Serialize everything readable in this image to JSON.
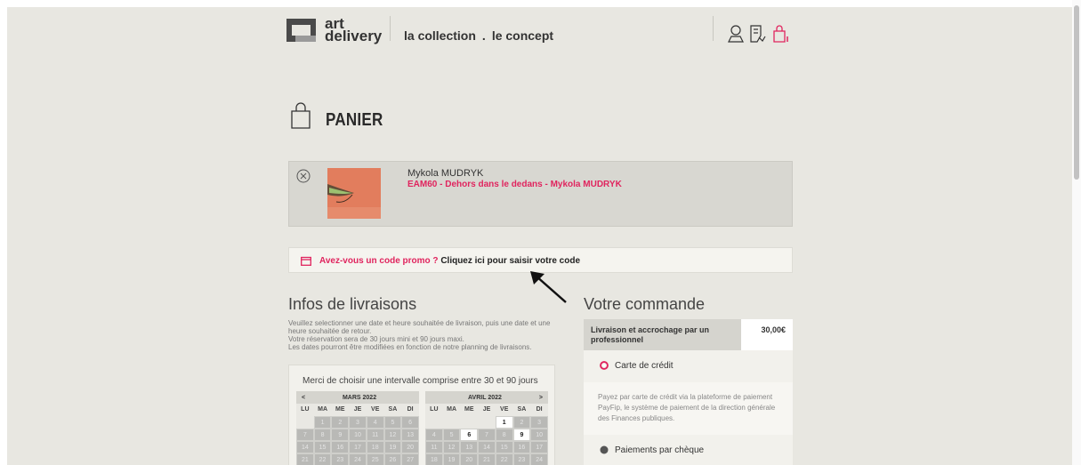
{
  "header": {
    "logo_line1": "art",
    "logo_line2": "delivery",
    "nav": [
      "la collection",
      ".",
      "le concept"
    ],
    "icons": [
      "user-icon",
      "document-icon",
      "cart-icon"
    ],
    "accent": "#e0245e"
  },
  "page": {
    "title": "PANIER"
  },
  "cart": {
    "items": [
      {
        "artist": "Mykola MUDRYK",
        "artwork": "EAM60 - Dehors dans le dedans - Mykola MUDRYK"
      }
    ]
  },
  "promo": {
    "question": "Avez-vous un code promo ?",
    "action": "Cliquez ici pour saisir votre code"
  },
  "delivery": {
    "title": "Infos de livraisons",
    "info_lines": [
      "Veuillez selectionner une date et heure souhaitée de livraison, puis une date et une heure souhaitée de retour.",
      "Votre réservation sera de 30 jours mini et 90 jours maxi.",
      "Les dates pourront être modifiées en fonction de notre planning de livraisons."
    ],
    "calendar_heading": "Merci de choisir une intervalle comprise entre 30 et 90 jours",
    "weekdays": [
      "LU",
      "MA",
      "ME",
      "JE",
      "VE",
      "SA",
      "DI"
    ],
    "months": [
      {
        "name": "MARS 2022",
        "prev": "<",
        "next": "",
        "days": [
          "",
          "1",
          "2",
          "3",
          "4",
          "5",
          "6",
          "7",
          "8",
          "9",
          "10",
          "11",
          "12",
          "13",
          "14",
          "15",
          "16",
          "17",
          "18",
          "19",
          "20",
          "21",
          "22",
          "23",
          "24",
          "25",
          "26",
          "27"
        ],
        "available": []
      },
      {
        "name": "AVRIL 2022",
        "prev": "",
        "next": ">",
        "days": [
          "",
          "",
          "",
          "",
          "1",
          "2",
          "3",
          "4",
          "5",
          "6",
          "7",
          "8",
          "9",
          "10",
          "11",
          "12",
          "13",
          "14",
          "15",
          "16",
          "17",
          "18",
          "19",
          "20",
          "21",
          "22",
          "23",
          "24"
        ],
        "available": [
          "1",
          "6",
          "9"
        ]
      }
    ]
  },
  "order": {
    "title": "Votre commande",
    "line_label": "Livraison et accrochage par un professionnel",
    "line_price": "30,00€",
    "payment_options": [
      {
        "label": "Carte de crédit",
        "selected": true,
        "color": "#e0245e"
      },
      {
        "label": "Paiements par chèque",
        "selected": false,
        "color": "#555555"
      }
    ],
    "card_description": "Payez par carte de crédit via la plateforme de paiement PayFip, le système de paiement de la direction générale des Finances publiques."
  }
}
